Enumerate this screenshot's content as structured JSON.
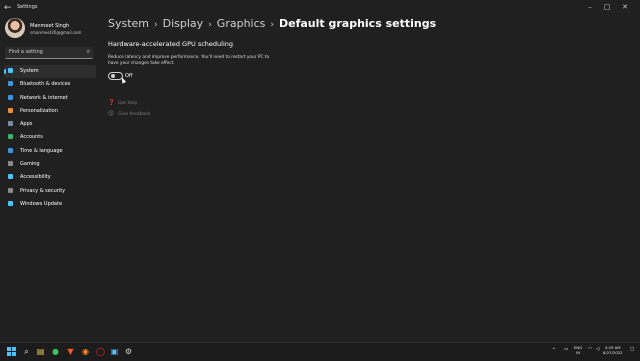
{
  "titlebar": {
    "title": "Settings",
    "back": "←",
    "minimize": "–",
    "maximize": "□",
    "close": "✕"
  },
  "profile": {
    "name": "Manmeet Singh",
    "email": "smanmeet20@gmail.com"
  },
  "search": {
    "placeholder": "Find a setting",
    "icon": "search-icon"
  },
  "sidebar": {
    "items": [
      {
        "label": "System",
        "icon": "display-icon",
        "color": "#4cc2ff",
        "selected": true
      },
      {
        "label": "Bluetooth & devices",
        "icon": "bluetooth-icon",
        "color": "#3a96dd"
      },
      {
        "label": "Network & internet",
        "icon": "wifi-icon",
        "color": "#3a96dd"
      },
      {
        "label": "Personalization",
        "icon": "brush-icon",
        "color": "#e8913a"
      },
      {
        "label": "Apps",
        "icon": "apps-icon",
        "color": "#7a8ba6"
      },
      {
        "label": "Accounts",
        "icon": "person-icon",
        "color": "#39b36b"
      },
      {
        "label": "Time & language",
        "icon": "globe-icon",
        "color": "#3a96dd"
      },
      {
        "label": "Gaming",
        "icon": "controller-icon",
        "color": "#8a8a8a"
      },
      {
        "label": "Accessibility",
        "icon": "accessibility-icon",
        "color": "#4cc2ff"
      },
      {
        "label": "Privacy & security",
        "icon": "shield-icon",
        "color": "#8a8a8a"
      },
      {
        "label": "Windows Update",
        "icon": "update-icon",
        "color": "#4cc2ff"
      }
    ]
  },
  "breadcrumb": {
    "items": [
      "System",
      "Display",
      "Graphics"
    ],
    "current": "Default graphics settings",
    "separator": "›"
  },
  "main": {
    "section_title": "Hardware-accelerated GPU scheduling",
    "description": "Reduce latency and improve performance. You'll need to restart your PC to have your changes take effect.",
    "toggle_state": "Off",
    "get_help": "Get help",
    "give_feedback": "Give feedback"
  },
  "taskbar": {
    "apps": [
      "start-icon",
      "search-icon",
      "file-explorer-icon",
      "chrome-icon",
      "brave-icon",
      "firefox-icon",
      "opera-icon",
      "store-icon",
      "settings-icon"
    ],
    "tray_chevron": "^",
    "language_top": "ENG",
    "language_bottom": "IN",
    "time": "4:29 AM",
    "date": "8/27/2022"
  }
}
